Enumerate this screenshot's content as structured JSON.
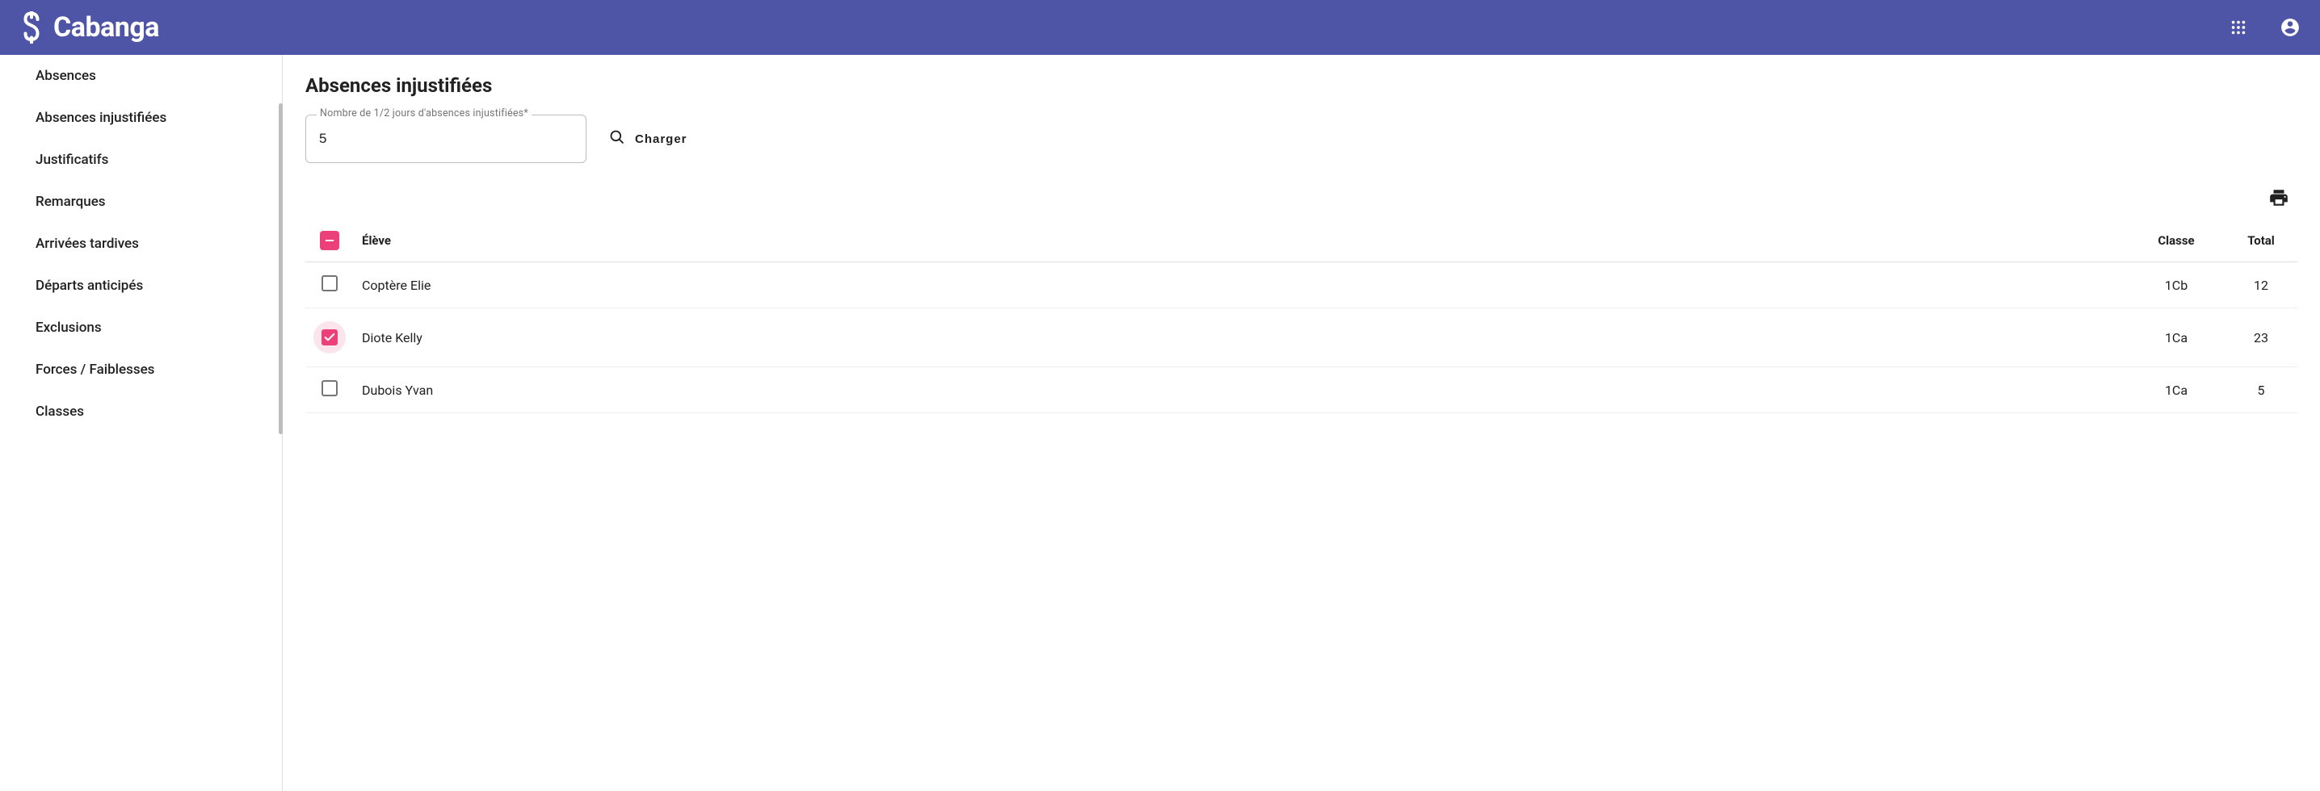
{
  "app": {
    "name": "Cabanga"
  },
  "sidebar": {
    "items": [
      {
        "label": "Absences"
      },
      {
        "label": "Absences injustifiées"
      },
      {
        "label": "Justificatifs"
      },
      {
        "label": "Remarques"
      },
      {
        "label": "Arrivées tardives"
      },
      {
        "label": "Départs anticipés"
      },
      {
        "label": "Exclusions"
      },
      {
        "label": "Forces / Faiblesses"
      },
      {
        "label": "Classes"
      }
    ]
  },
  "page": {
    "title": "Absences injustifiées",
    "filter": {
      "label": "Nombre de 1/2 jours d'absences injustifiées*",
      "value": "5"
    },
    "loadButton": "Charger"
  },
  "table": {
    "headers": {
      "eleve": "Élève",
      "classe": "Classe",
      "total": "Total"
    },
    "rows": [
      {
        "checked": false,
        "name": "Coptère Elie",
        "classe": "1Cb",
        "total": "12"
      },
      {
        "checked": true,
        "name": "Diote Kelly",
        "classe": "1Ca",
        "total": "23"
      },
      {
        "checked": false,
        "name": "Dubois Yvan",
        "classe": "1Ca",
        "total": "5"
      }
    ]
  }
}
